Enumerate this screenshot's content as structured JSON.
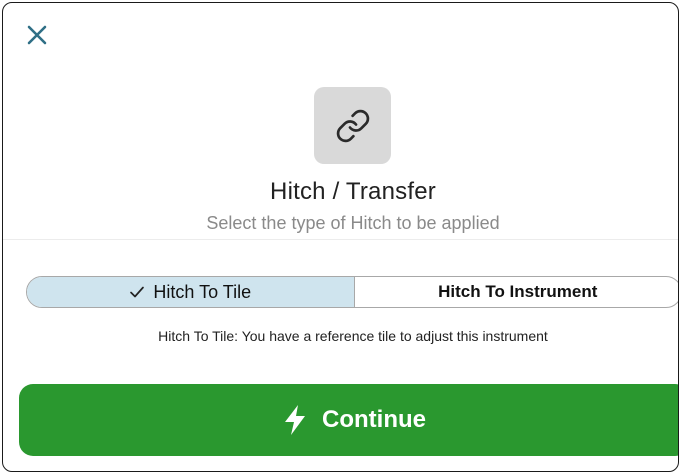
{
  "dialog": {
    "title": "Hitch / Transfer",
    "subtitle": "Select the type of Hitch to be applied",
    "icon": "link-icon"
  },
  "options": [
    {
      "label": "Hitch To Tile",
      "selected": true
    },
    {
      "label": "Hitch To Instrument",
      "selected": false
    }
  ],
  "description": "Hitch To Tile: You have a reference tile to adjust this instrument",
  "continue": {
    "label": "Continue",
    "icon": "lightning-bolt-icon"
  },
  "colors": {
    "accent_green": "#2a982f",
    "selected_segment": "#cfe4ee",
    "close_icon": "#2f6f86"
  }
}
